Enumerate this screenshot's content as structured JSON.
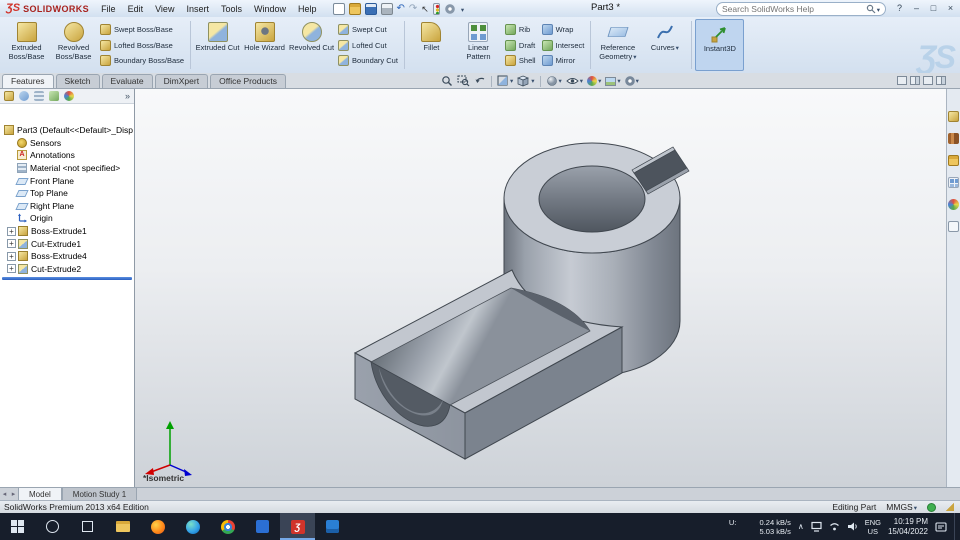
{
  "titlebar": {
    "brand": "SOLIDWORKS",
    "brand_mark": "ƷS",
    "menus": [
      "File",
      "Edit",
      "View",
      "Insert",
      "Tools",
      "Window",
      "Help"
    ],
    "document_title": "Part3 *",
    "search_placeholder": "Search SolidWorks Help",
    "window_controls": {
      "help": "?",
      "minimize": "–",
      "maximize": "□",
      "close": "×"
    }
  },
  "ribbon": {
    "watermark": "ƷS",
    "buttons": [
      {
        "label": "Extruded Boss/Base"
      },
      {
        "label": "Revolved Boss/Base"
      },
      {
        "label": "Swept Boss/Base"
      },
      {
        "label": "Lofted Boss/Base"
      },
      {
        "label": "Boundary Boss/Base"
      },
      {
        "label": "Extruded Cut"
      },
      {
        "label": "Hole Wizard"
      },
      {
        "label": "Revolved Cut"
      },
      {
        "label": "Swept Cut"
      },
      {
        "label": "Lofted Cut"
      },
      {
        "label": "Boundary Cut"
      },
      {
        "label": "Fillet"
      },
      {
        "label": "Linear Pattern"
      },
      {
        "label": "Rib"
      },
      {
        "label": "Draft"
      },
      {
        "label": "Shell"
      },
      {
        "label": "Wrap"
      },
      {
        "label": "Intersect"
      },
      {
        "label": "Mirror"
      },
      {
        "label": "Reference Geometry"
      },
      {
        "label": "Curves"
      },
      {
        "label": "Instant3D"
      }
    ]
  },
  "feature_tabs": [
    "Features",
    "Sketch",
    "Evaluate",
    "DimXpert",
    "Office Products"
  ],
  "panel": {
    "overflow": "»"
  },
  "tree": {
    "root": "Part3 (Default<<Default>_Disp",
    "items": [
      {
        "label": "Sensors"
      },
      {
        "label": "Annotations"
      },
      {
        "label": "Material <not specified>"
      },
      {
        "label": "Front Plane"
      },
      {
        "label": "Top Plane"
      },
      {
        "label": "Right Plane"
      },
      {
        "label": "Origin"
      },
      {
        "label": "Boss-Extrude1"
      },
      {
        "label": "Cut-Extrude1"
      },
      {
        "label": "Boss-Extrude4"
      },
      {
        "label": "Cut-Extrude2"
      }
    ]
  },
  "viewport": {
    "view_label": "*Isometric"
  },
  "bottom_tabs": {
    "model": "Model",
    "motion": "Motion Study 1"
  },
  "statusbar": {
    "edition": "SolidWorks Premium 2013 x64 Edition",
    "mode": "Editing Part",
    "units": "MMGS"
  },
  "tray": {
    "chevron": "∧",
    "up_label": "U:",
    "up_speed": "0.24 kB/s",
    "down_speed": "5.03 kB/s",
    "lang": "ENG",
    "region": "US",
    "time": "10:19 PM",
    "date": "15/04/2022"
  }
}
